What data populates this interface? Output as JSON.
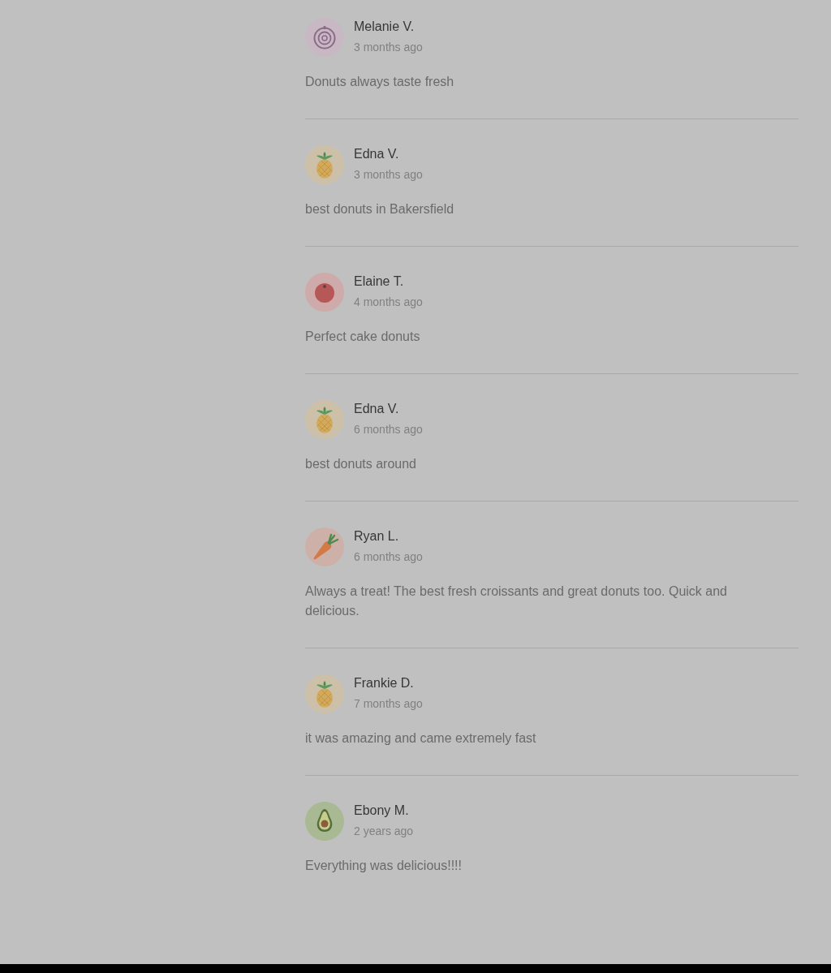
{
  "reviews": [
    {
      "name": "Melanie V.",
      "time": "3 months ago",
      "text": "Donuts always taste fresh",
      "avatar": {
        "kind": "onion"
      }
    },
    {
      "name": "Edna V.",
      "time": "3 months ago",
      "text": "best donuts in Bakersfield",
      "avatar": {
        "kind": "pineapple"
      }
    },
    {
      "name": "Elaine T.",
      "time": "4 months ago",
      "text": "Perfect cake donuts",
      "avatar": {
        "kind": "tomato"
      }
    },
    {
      "name": "Edna V.",
      "time": "6 months ago",
      "text": "best donuts around",
      "avatar": {
        "kind": "pineapple"
      }
    },
    {
      "name": "Ryan L.",
      "time": "6 months ago",
      "text": "Always a treat! The best fresh croissants and great donuts too. Quick and delicious.",
      "avatar": {
        "kind": "carrot"
      }
    },
    {
      "name": "Frankie D.",
      "time": "7 months ago",
      "text": "it was amazing and came extremely fast",
      "avatar": {
        "kind": "pineapple"
      }
    },
    {
      "name": "Ebony M.",
      "time": "2 years ago",
      "text": "Everything was delicious!!!!",
      "avatar": {
        "kind": "avocado"
      }
    }
  ]
}
